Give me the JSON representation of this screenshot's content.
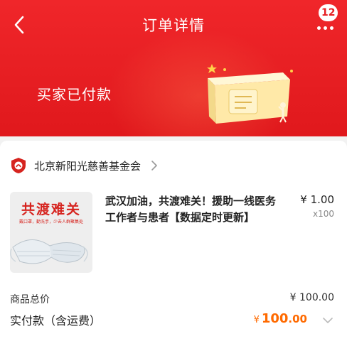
{
  "header": {
    "title": "订单详情",
    "notification_count": "12",
    "status": "买家已付款",
    "colors": {
      "primary": "#e61e22",
      "accent": "#ff6a00"
    }
  },
  "shop": {
    "name": "北京新阳光慈善基金会"
  },
  "product": {
    "thumbnail_title": "共渡难关",
    "thumbnail_subtitle": "戴口罩，勤洗手，少去人群聚集处",
    "title": "武汉加油，共渡难关！援助一线医务工作者与患者【数据定时更新】",
    "price": "¥ 1.00",
    "quantity": "x100"
  },
  "summary": {
    "total_label": "商品总价",
    "total_value": "¥ 100.00",
    "paid_label": "实付款（含运费）",
    "paid_currency": "¥",
    "paid_integer": "100",
    "paid_decimal": ".00"
  },
  "icons": {
    "back": "chevron-left-icon",
    "more": "more-dots-icon",
    "shop": "charity-logo-icon",
    "shop_chevron": "chevron-right-icon",
    "expand": "chevron-down-icon"
  }
}
